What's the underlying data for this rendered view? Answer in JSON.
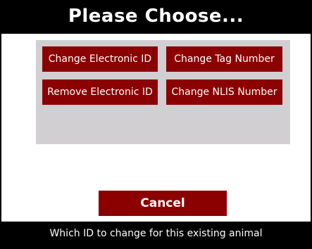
{
  "dialog": {
    "title": "Please Choose...",
    "options": [
      {
        "label": "Change Electronic ID"
      },
      {
        "label": "Change Tag Number"
      },
      {
        "label": "Remove Electronic ID"
      },
      {
        "label": "Change NLIS Number"
      }
    ],
    "cancel_label": "Cancel",
    "status_text": "Which ID to change for this existing animal"
  },
  "colors": {
    "title_bar_bg": "#000000",
    "button_bg": "#8b0000",
    "panel_bg": "#d2cfd2",
    "text_light": "#ffffff"
  }
}
